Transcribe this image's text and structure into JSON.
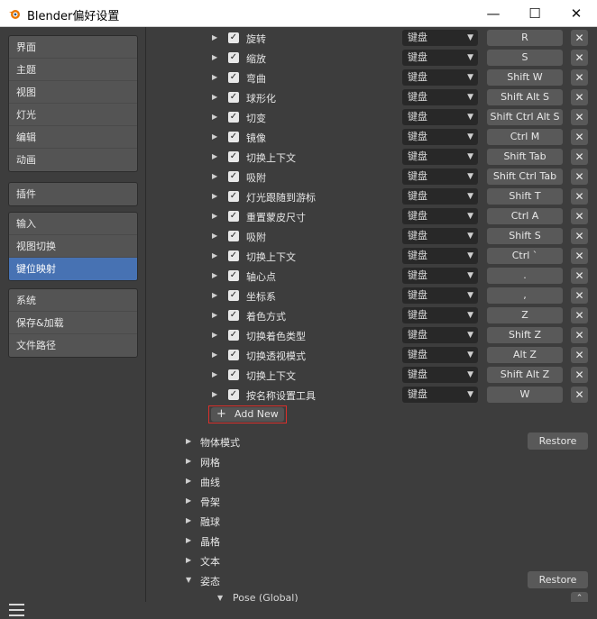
{
  "window": {
    "title": "Blender偏好设置",
    "minimize": "—",
    "maximize": "☐",
    "close": "✕"
  },
  "sidebar": {
    "groups": [
      {
        "items": [
          {
            "label": "界面"
          },
          {
            "label": "主题"
          },
          {
            "label": "视图"
          },
          {
            "label": "灯光"
          },
          {
            "label": "编辑"
          },
          {
            "label": "动画"
          }
        ]
      },
      {
        "items": [
          {
            "label": "插件"
          }
        ]
      },
      {
        "items": [
          {
            "label": "输入"
          },
          {
            "label": "视图切换"
          },
          {
            "label": "键位映射",
            "active": true
          }
        ]
      },
      {
        "items": [
          {
            "label": "系统"
          },
          {
            "label": "保存&加载"
          },
          {
            "label": "文件路径"
          }
        ]
      }
    ]
  },
  "keymap": {
    "items": [
      {
        "name": "旋转",
        "type": "键盘",
        "key": "R",
        "checked": true
      },
      {
        "name": "缩放",
        "type": "键盘",
        "key": "S",
        "checked": true
      },
      {
        "name": "弯曲",
        "type": "键盘",
        "key": "Shift W",
        "checked": true
      },
      {
        "name": "球形化",
        "type": "键盘",
        "key": "Shift Alt S",
        "checked": true
      },
      {
        "name": "切变",
        "type": "键盘",
        "key": "Shift Ctrl Alt S",
        "checked": true
      },
      {
        "name": "镜像",
        "type": "键盘",
        "key": "Ctrl M",
        "checked": true
      },
      {
        "name": "切换上下文",
        "type": "键盘",
        "key": "Shift Tab",
        "checked": true
      },
      {
        "name": "吸附",
        "type": "键盘",
        "key": "Shift Ctrl Tab",
        "checked": true
      },
      {
        "name": "灯光跟随到游标",
        "type": "键盘",
        "key": "Shift T",
        "checked": true
      },
      {
        "name": "重置蒙皮尺寸",
        "type": "键盘",
        "key": "Ctrl A",
        "checked": true
      },
      {
        "name": "吸附",
        "type": "键盘",
        "key": "Shift S",
        "checked": true
      },
      {
        "name": "切换上下文",
        "type": "键盘",
        "key": "Ctrl `",
        "checked": true
      },
      {
        "name": "轴心点",
        "type": "键盘",
        "key": ".",
        "checked": true
      },
      {
        "name": "坐标系",
        "type": "键盘",
        "key": ",",
        "checked": true
      },
      {
        "name": "着色方式",
        "type": "键盘",
        "key": "Z",
        "checked": true
      },
      {
        "name": "切换着色类型",
        "type": "键盘",
        "key": "Shift Z",
        "checked": true
      },
      {
        "name": "切换透视模式",
        "type": "键盘",
        "key": "Alt Z",
        "checked": true
      },
      {
        "name": "切换上下文",
        "type": "键盘",
        "key": "Shift Alt Z",
        "checked": true
      },
      {
        "name": "按名称设置工具",
        "type": "键盘",
        "key": "W",
        "checked": true
      }
    ],
    "add_new": {
      "plus": "+",
      "label": "Add New"
    },
    "categories": [
      {
        "name": "物体模式",
        "restore": "Restore"
      },
      {
        "name": "网格"
      },
      {
        "name": "曲线"
      },
      {
        "name": "骨架"
      },
      {
        "name": "融球"
      },
      {
        "name": "晶格"
      },
      {
        "name": "文本"
      },
      {
        "name": "姿态",
        "restore": "Restore",
        "expanded": true
      }
    ],
    "subcategory": {
      "name": "Pose (Global)"
    }
  }
}
